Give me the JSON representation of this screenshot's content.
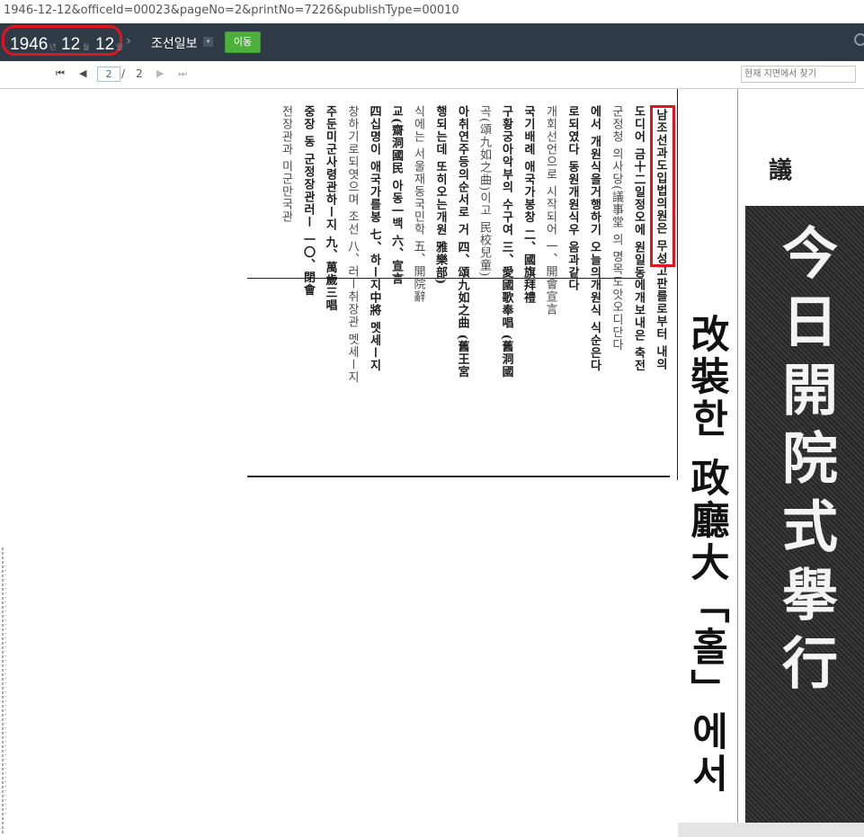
{
  "url": "1946-12-12&officeId=00023&pageNo=2&printNo=7226&publishType=00010",
  "toolbar": {
    "year": "1946",
    "year_unit": "년",
    "month": "12",
    "month_unit": "월",
    "day": "12",
    "day_unit": "일",
    "next_date_glyph": "›",
    "newspaper": "조선일보",
    "dropdown_glyph": "▾",
    "go_label": "이동"
  },
  "pagenav": {
    "first_glyph": "⏮",
    "prev_glyph": "◀",
    "current_page": "2",
    "separator": "/",
    "total_pages": "2",
    "next_glyph": "▶",
    "last_glyph": "⏭",
    "search_placeholder": "현재 지면에서 찾기"
  },
  "article": {
    "columns": [
      "남조선과도입법의원은 무성고판를로부터 내의",
      "도디어 금十二일정오에 원일동에개보내은 축전",
      "군정청 의사당(議事堂 의 명목도앗오디단다",
      "에서 개원식을거행하기 오늘의개원식 식순은다",
      "로되였다 동원개원식우 음과같다",
      "개회선언으로 시작되어 一、開會宣言",
      "국기배례 애국가봉창 二、國旗拜禮",
      "구황궁아악부의 수구여 三、愛國歌奉唱 (舊洞國",
      "곡(頌九如之曲)이고 民校兒童)",
      "아취연주등의순서로 거 四、頌九如之曲 (舊王宮",
      "행되는데 또히오는개원 雅樂部)",
      "식에는 서울재동국민학 五、開院辭",
      "교(齋洞國民 아동一백 六、宣言",
      "四십명이 애국가를봉 七、하ー지中將 멧세ー지",
      "창하기로되엿으며 조선 八、러ー취장관 멧세ー지",
      "주둔미군사령관하ー지 九、萬歲三唱",
      "중장 동 군정장관러ー 一〇、閉會",
      "전장관과 미군만국관"
    ],
    "headline_vertical": "改裝한 政廳大「홀」에서",
    "banner_text": "今日開院式擧行",
    "corner_char": "議"
  }
}
